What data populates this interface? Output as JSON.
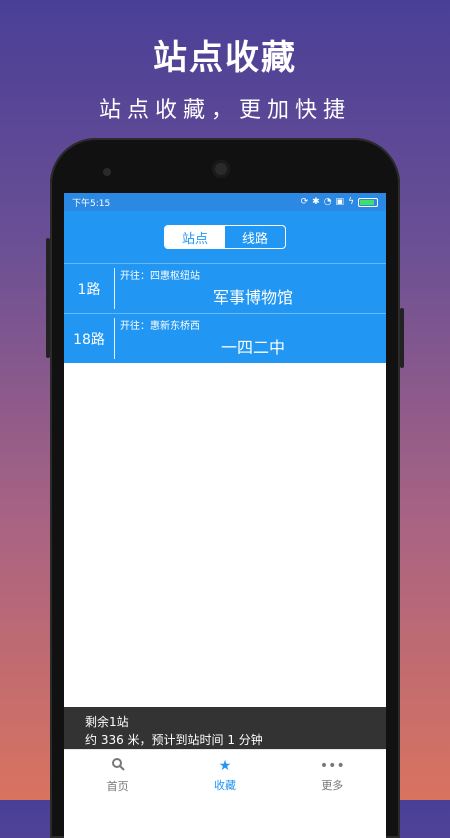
{
  "hero": {
    "title": "站点收藏",
    "subtitle": "站点收藏，更加快捷"
  },
  "status_bar": {
    "time": "下午5:15",
    "icons": [
      "sync-icon",
      "bluetooth-icon",
      "wifi-icon",
      "sim-icon",
      "charge-icon",
      "battery-icon"
    ]
  },
  "segmented": {
    "options": [
      "站点",
      "线路"
    ],
    "selected": "站点"
  },
  "favorites": [
    {
      "route": "1路",
      "direction": "开往：四惠枢纽站",
      "stop": "军事博物馆"
    },
    {
      "route": "18路",
      "direction": "开往：惠新东桥西",
      "stop": "一四二中"
    }
  ],
  "arrival": {
    "remaining": "剩余1站",
    "details": "约 336 米，预计到站时间 1 分钟"
  },
  "tabs": [
    {
      "label": "首页",
      "icon": "search-icon"
    },
    {
      "label": "收藏",
      "icon": "star-icon"
    },
    {
      "label": "更多",
      "icon": "more-icon"
    }
  ],
  "colors": {
    "primary": "#2196f3",
    "footer": "#333333"
  }
}
